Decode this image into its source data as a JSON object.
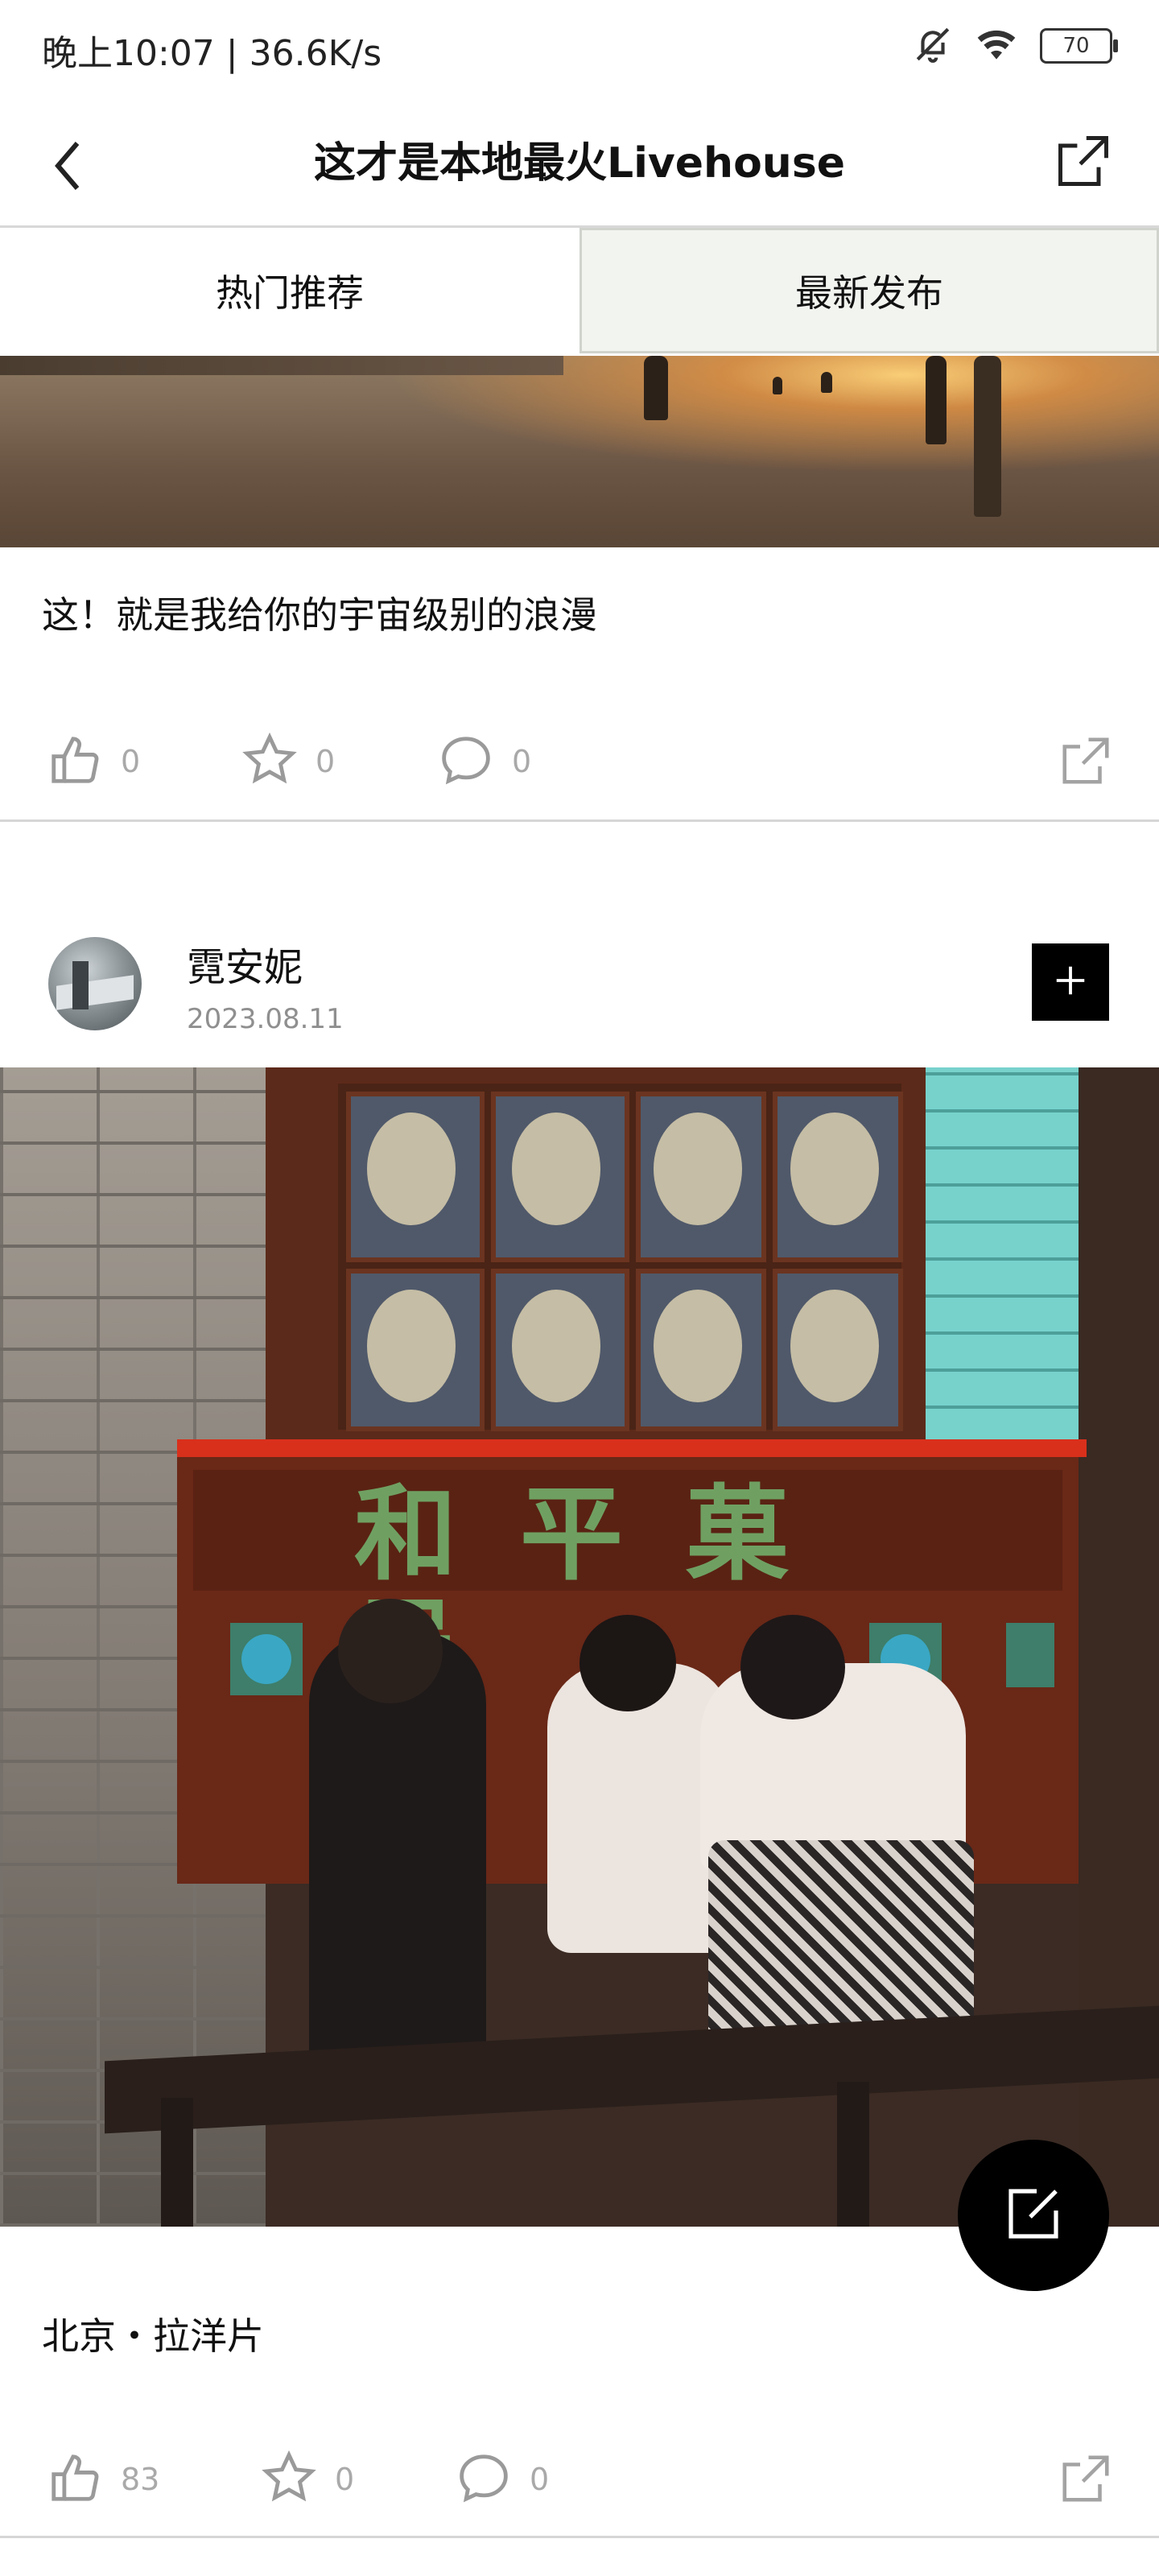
{
  "status_bar": {
    "time_speed": "晚上10:07 | 36.6K/s",
    "battery": "70"
  },
  "nav": {
    "title": "这才是本地最火Livehouse"
  },
  "tabs": [
    {
      "label": "热门推荐"
    },
    {
      "label": "最新发布",
      "selected": true
    }
  ],
  "post1": {
    "text": "这！就是我给你的宇宙级别的浪漫",
    "likes": "0",
    "favorites": "0",
    "comments": "0"
  },
  "post2": {
    "author": "霓安妮",
    "date": "2023.08.11",
    "sign_text": "和平菓局",
    "text": "北京・拉洋片",
    "likes": "83",
    "favorites": "0",
    "comments": "0"
  },
  "icons": {
    "back": "chevron-left-icon",
    "share": "share-icon",
    "like": "thumbs-up-icon",
    "favorite": "star-icon",
    "comment": "comment-icon",
    "follow": "plus-icon",
    "compose": "edit-icon",
    "mute": "bell-off-icon",
    "wifi": "wifi-icon",
    "battery": "battery-icon"
  }
}
